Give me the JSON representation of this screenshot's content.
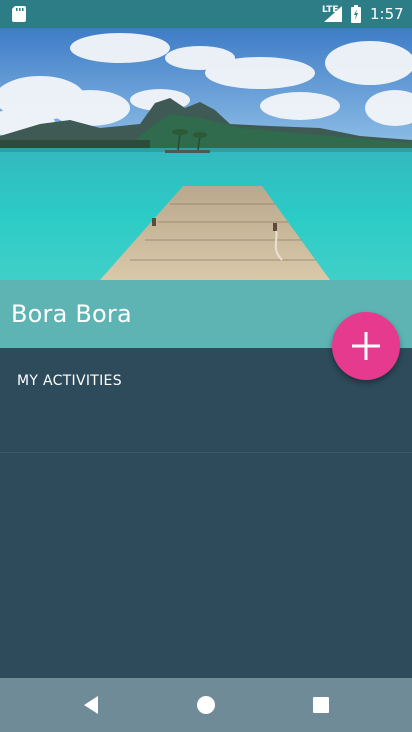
{
  "status_bar": {
    "time": "1:57",
    "network_label": "LTE",
    "icons": [
      "sd-card-icon",
      "signal-icon",
      "battery-icon"
    ]
  },
  "hero": {
    "image": "tropical-dock-photo"
  },
  "destination": {
    "title": "Bora Bora"
  },
  "activities": {
    "section_label": "MY ACTIVITIES"
  },
  "fab": {
    "icon": "plus-icon"
  },
  "nav_bar": {
    "icons": [
      "back-icon",
      "home-icon",
      "recents-icon"
    ]
  },
  "colors": {
    "status_bar": "#2d7d86",
    "title_bar": "#5db4b3",
    "content": "#2d4b5b",
    "fab": "#e63a8e",
    "nav_bar": "#6f8b97"
  }
}
